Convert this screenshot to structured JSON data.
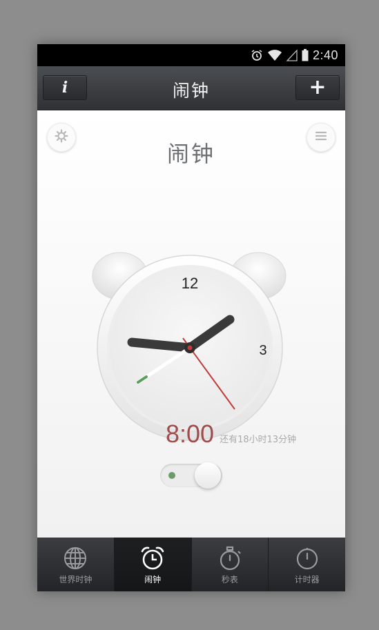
{
  "status_bar": {
    "time": "2:40",
    "icons": [
      "alarm-icon",
      "wifi-icon",
      "signal-icon",
      "battery-icon"
    ]
  },
  "top_bar": {
    "title": "闹钟",
    "info_label": "i",
    "add_label": "+"
  },
  "main": {
    "title": "闹钟",
    "clock_numbers": [
      "12",
      "3"
    ]
  },
  "alarm": {
    "time": "8:00",
    "remaining": "还有18小时13分钟",
    "enabled": true
  },
  "tabs": [
    {
      "label": "世界时钟",
      "icon": "globe-icon",
      "active": false
    },
    {
      "label": "闹钟",
      "icon": "alarm-clock-icon",
      "active": true
    },
    {
      "label": "秒表",
      "icon": "stopwatch-icon",
      "active": false
    },
    {
      "label": "计时器",
      "icon": "timer-icon",
      "active": false
    }
  ],
  "colors": {
    "accent_time": "#a14c4c",
    "second_hand": "#c23a3a",
    "toggle_on": "#6c9b6a"
  }
}
